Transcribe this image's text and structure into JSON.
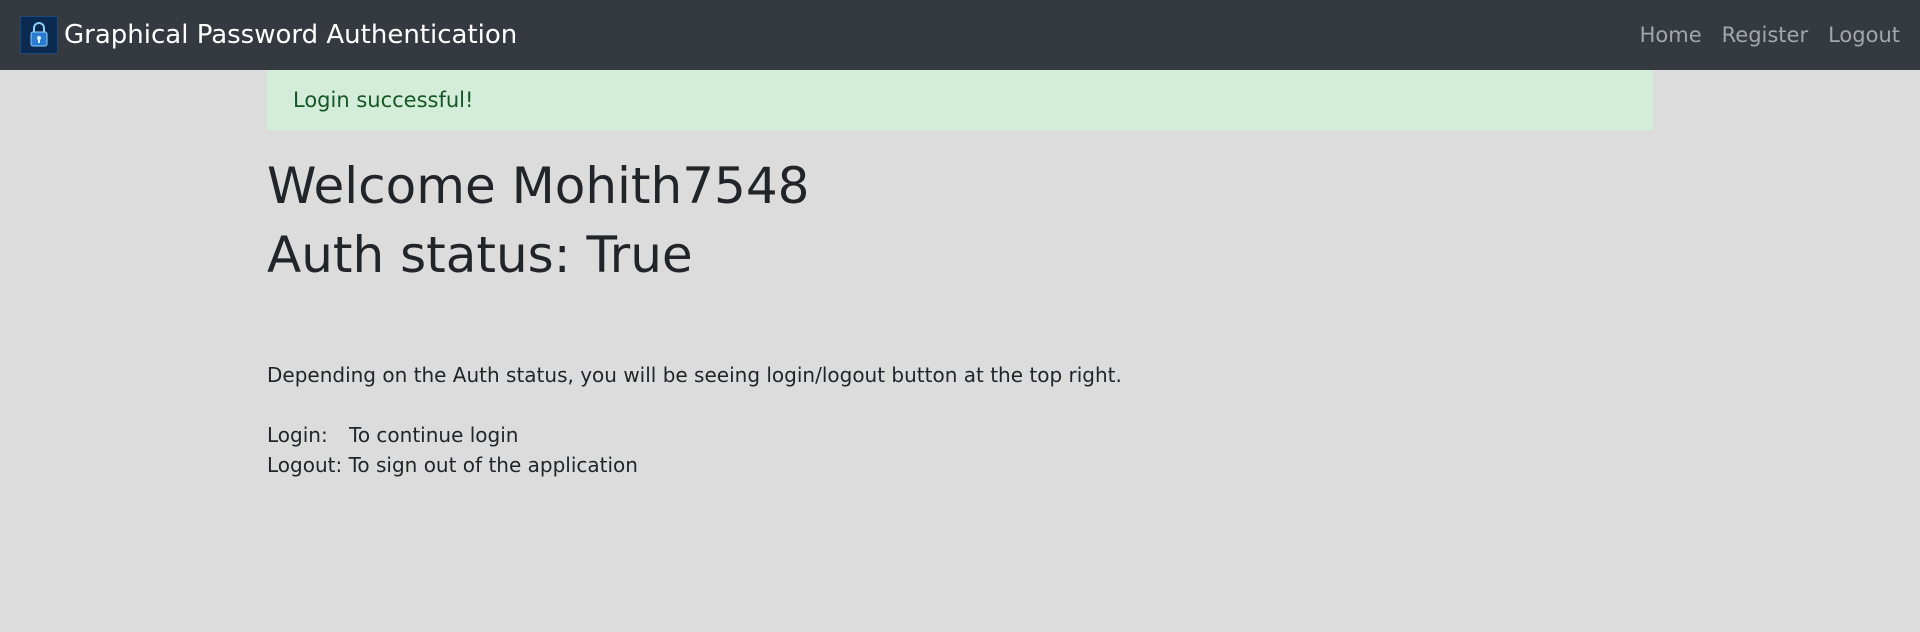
{
  "navbar": {
    "brand_title": "Graphical Password Authentication",
    "logo_icon": "padlock-icon",
    "links": [
      "Home",
      "Register",
      "Logout"
    ]
  },
  "alert": {
    "message": "Login successful!"
  },
  "main": {
    "welcome_prefix": "Welcome",
    "username": "Mohith7548",
    "auth_label": "Auth status:",
    "auth_value": "True",
    "description": "Depending on the Auth status, you will be seeing login/logout button at the top right.",
    "login_key": "Login:",
    "login_desc": "To continue login",
    "logout_key": "Logout:",
    "logout_desc": "To sign out of the application"
  },
  "colors": {
    "navbar_bg": "#343a40",
    "page_bg": "#dcdcdc",
    "alert_bg": "#d4edda",
    "alert_text": "#155724"
  }
}
